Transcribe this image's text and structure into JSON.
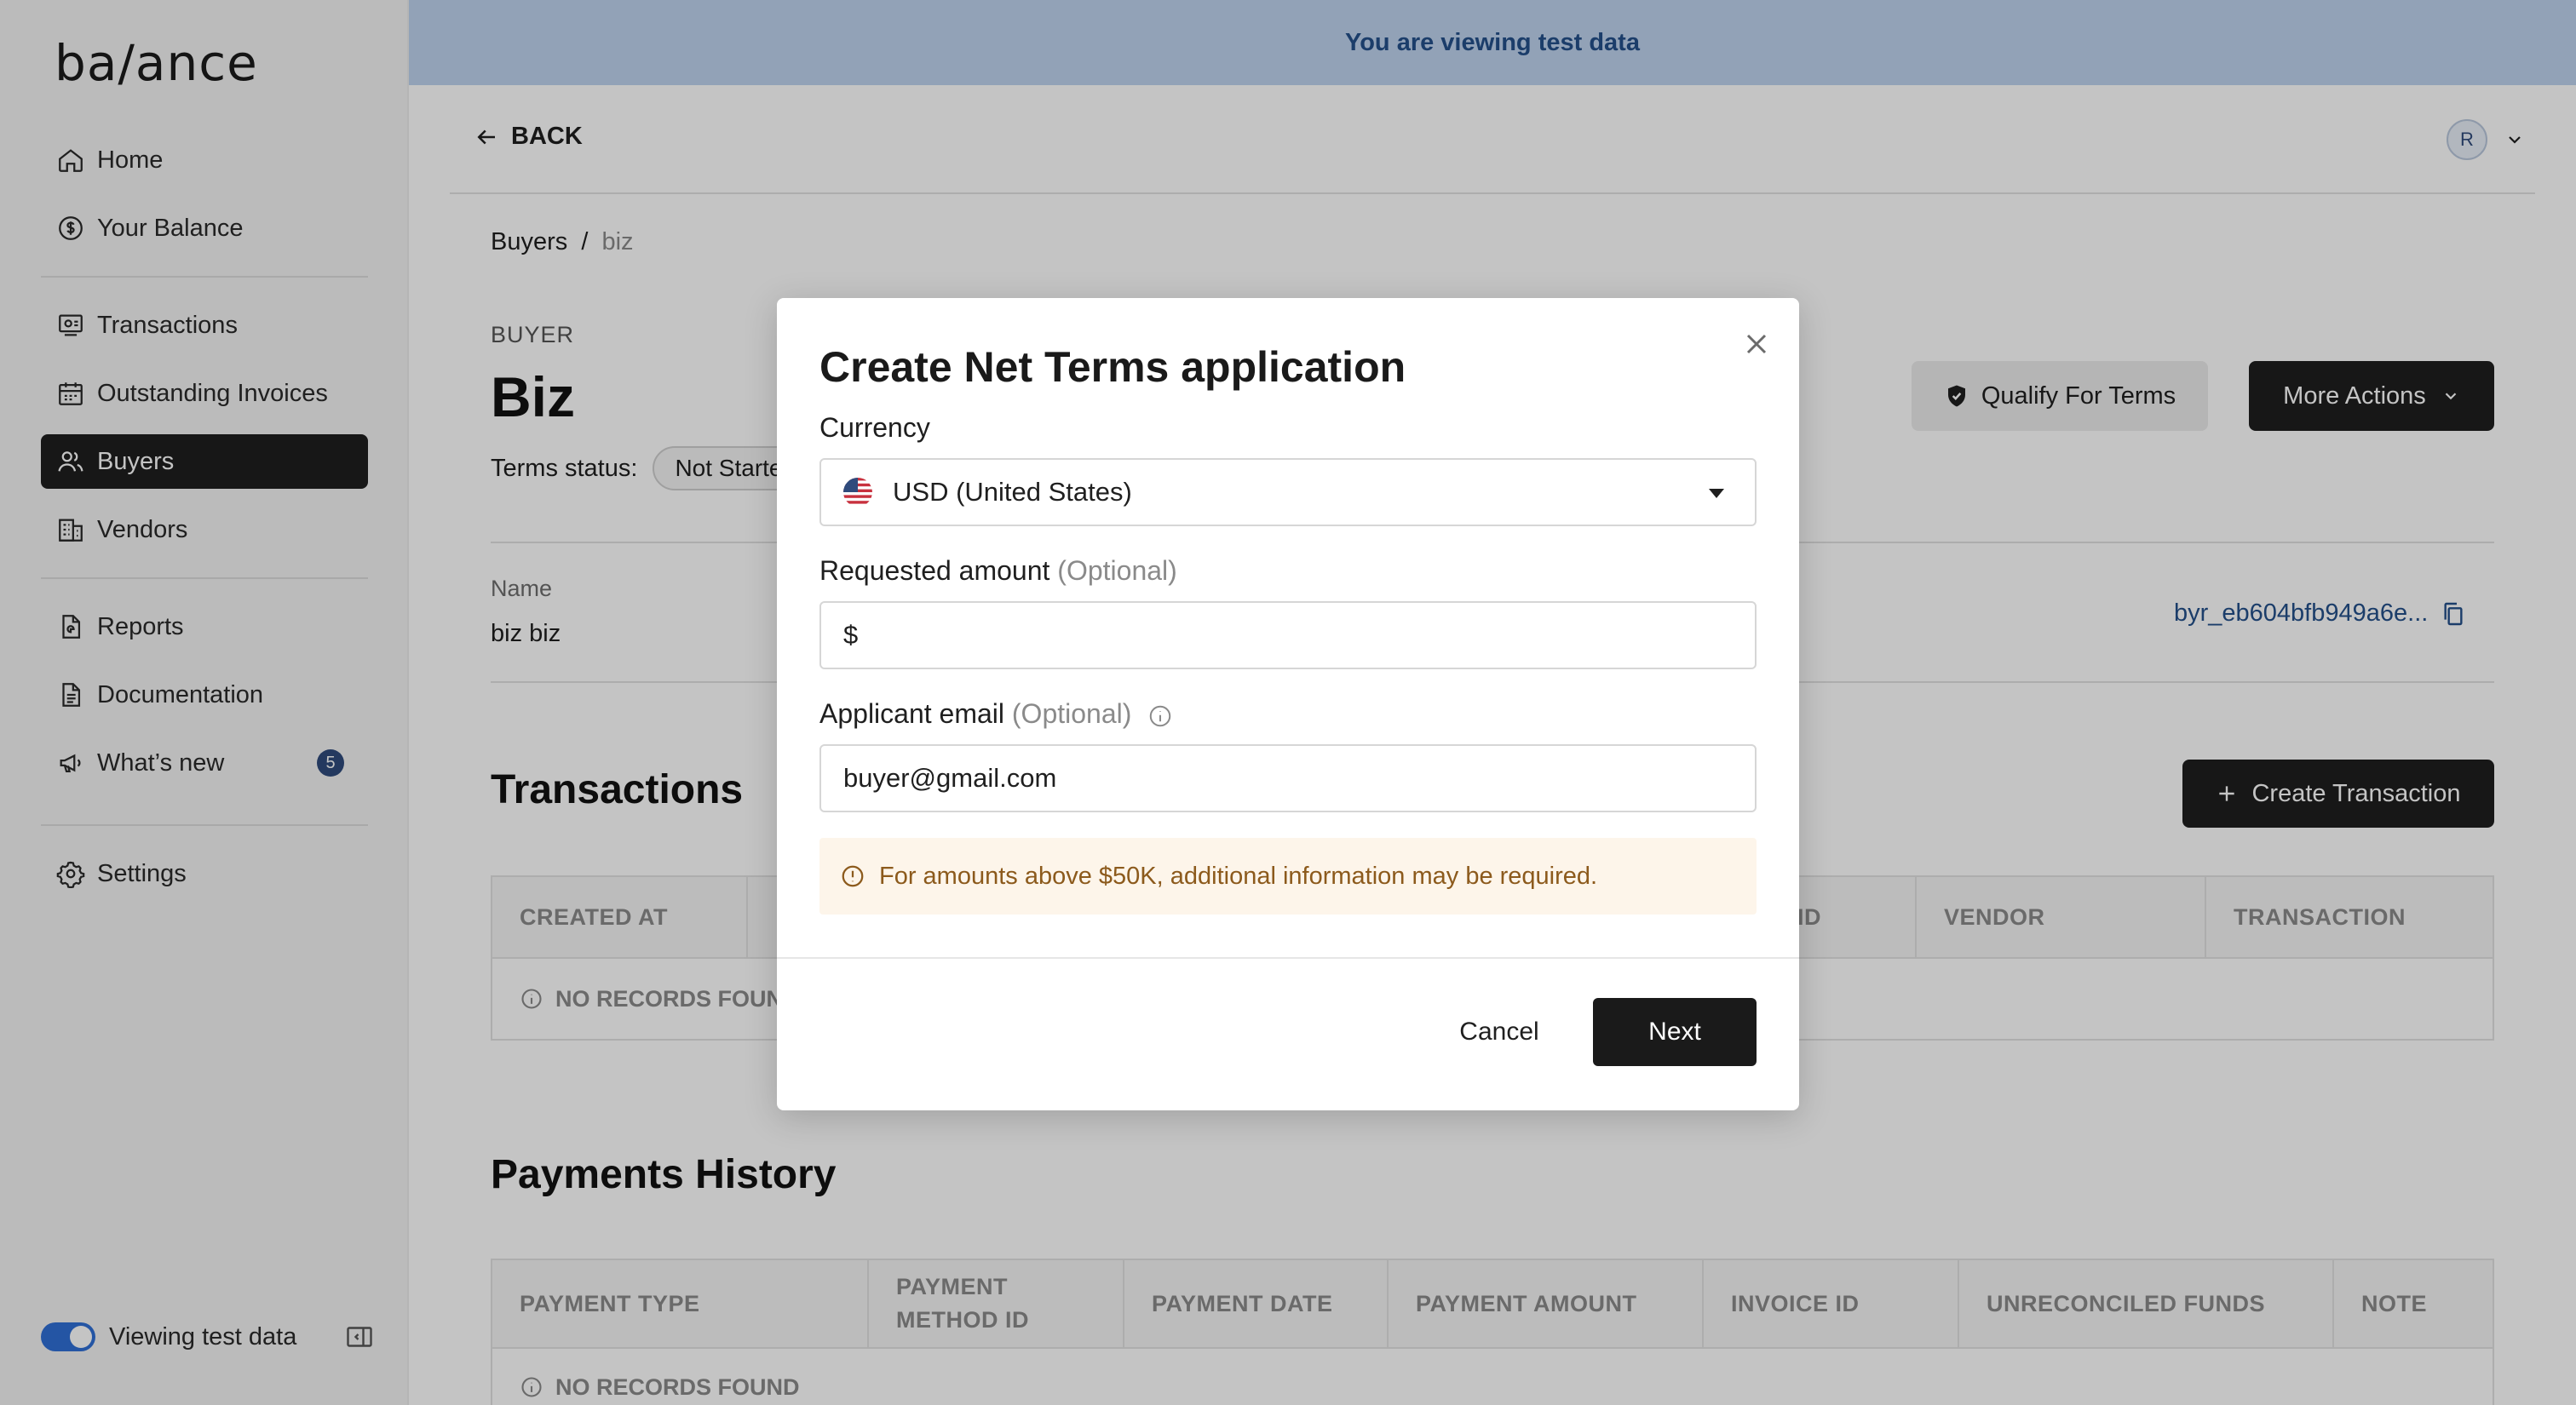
{
  "app": {
    "logo": "ba/ance"
  },
  "sidebar": {
    "items": [
      {
        "label": "Home",
        "icon": "home-icon"
      },
      {
        "label": "Your Balance",
        "icon": "dollar-circle-icon"
      },
      {
        "label": "Transactions",
        "icon": "transactions-icon"
      },
      {
        "label": "Outstanding Invoices",
        "icon": "calendar-icon"
      },
      {
        "label": "Buyers",
        "icon": "users-icon",
        "active": true
      },
      {
        "label": "Vendors",
        "icon": "building-icon"
      },
      {
        "label": "Reports",
        "icon": "report-icon"
      },
      {
        "label": "Documentation",
        "icon": "document-icon"
      },
      {
        "label": "What’s new",
        "icon": "megaphone-icon",
        "badge": "5"
      },
      {
        "label": "Settings",
        "icon": "gear-icon"
      }
    ],
    "test_toggle_label": "Viewing test data",
    "test_toggle_on": true
  },
  "banner": {
    "text": "You are viewing test data"
  },
  "header": {
    "back_label": "BACK",
    "avatar_initial": "R"
  },
  "breadcrumb": {
    "parent": "Buyers",
    "separator": "/",
    "current": "biz"
  },
  "buyer": {
    "eyebrow": "BUYER",
    "title": "Biz",
    "terms_status_label": "Terms status:",
    "terms_status_value": "Not Started",
    "qualify_label": "Qualify For Terms",
    "more_actions_label": "More Actions",
    "name_label": "Name",
    "name_value": "biz biz",
    "id_value": "byr_eb604bfb949a6e..."
  },
  "transactions": {
    "title": "Transactions",
    "create_label": "Create Transaction",
    "columns": [
      "CREATED AT",
      "",
      "",
      "",
      "ID",
      "VENDOR",
      "TRANSACTION"
    ],
    "empty": "NO RECORDS FOUND"
  },
  "payments": {
    "title": "Payments History",
    "columns": [
      "PAYMENT TYPE",
      "PAYMENT METHOD ID",
      "PAYMENT DATE",
      "PAYMENT AMOUNT",
      "INVOICE ID",
      "UNRECONCILED FUNDS",
      "NOTE"
    ],
    "empty": "NO RECORDS FOUND"
  },
  "modal": {
    "title": "Create Net Terms application",
    "currency_label": "Currency",
    "currency_value": "USD (United States)",
    "amount_label": "Requested amount",
    "amount_optional": "(Optional)",
    "amount_prefix": "$",
    "email_label": "Applicant email",
    "email_optional": "(Optional)",
    "email_value": "buyer@gmail.com",
    "notice": "For amounts above $50K, additional information may be required.",
    "cancel_label": "Cancel",
    "next_label": "Next"
  },
  "colors": {
    "accent": "#1f1f1f",
    "banner_bg": "#bfd3ef",
    "link": "#24508a",
    "notice_bg": "#fdf5ea",
    "notice_text": "#8c5a1c"
  }
}
